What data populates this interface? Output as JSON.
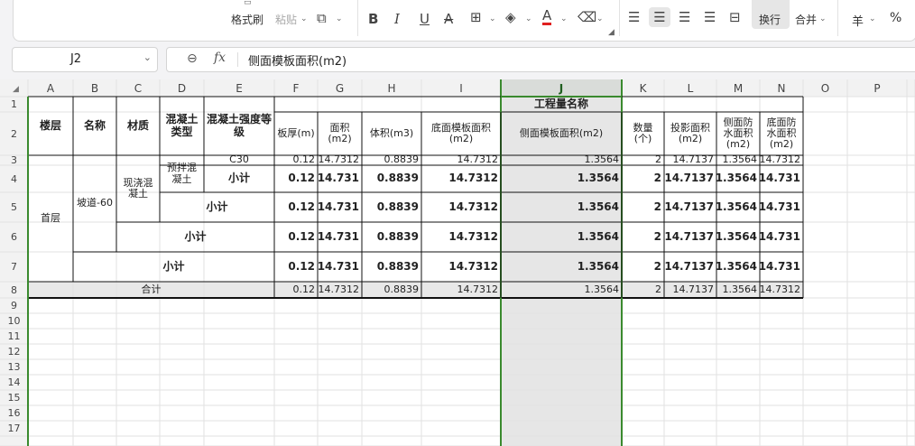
{
  "ribbon": {
    "format_painter": "格式刷",
    "paste": "粘贴",
    "bold": "B",
    "italic": "I",
    "underline": "U",
    "strike": "A",
    "font_color": "A",
    "wrap_text": "换行",
    "merge": "合并",
    "currency": "羊",
    "percent": "%"
  },
  "formula_bar": {
    "name_box": "J2",
    "formula": "侧面模板面积(m2)"
  },
  "columns": [
    "A",
    "B",
    "C",
    "D",
    "E",
    "F",
    "G",
    "H",
    "I",
    "J",
    "K",
    "L",
    "M",
    "N",
    "O",
    "P"
  ],
  "rows": [
    "1",
    "2",
    "3",
    "4",
    "5",
    "6",
    "7",
    "8",
    "9",
    "10",
    "11",
    "12",
    "13",
    "14",
    "15",
    "16",
    "17"
  ],
  "table": {
    "header_group": "工程量名称",
    "headers": {
      "A": "楼层",
      "B": "名称",
      "C": "材质",
      "D": "混凝土类型",
      "E": "混凝土强度等级",
      "F": "板厚(m)",
      "G": "面积(m2)",
      "H": "体积(m3)",
      "I": "底面模板面积(m2)",
      "J": "侧面模板面积(m2)",
      "K": "数量(个)",
      "L": "投影面积(m2)",
      "M": "侧面防水面积(m2)",
      "N": "底面防水面积(m2)"
    },
    "floor": "首层",
    "name": "坡道-60",
    "material": "现浇混凝土",
    "concrete_type": "预拌混凝土",
    "grade": "C30",
    "subtotal": "小计",
    "total": "合计",
    "detail_row": [
      "0.12",
      "14.7312",
      "0.8839",
      "14.7312",
      "1.3564",
      "2",
      "14.7137",
      "1.3564",
      "14.7312"
    ],
    "subtotal_row": [
      "0.12",
      "14.731",
      "0.8839",
      "14.7312",
      "1.3564",
      "2",
      "14.7137",
      "1.3564",
      "14.731"
    ],
    "total_row": [
      "0.12",
      "14.7312",
      "0.8839",
      "14.7312",
      "1.3564",
      "2",
      "14.7137",
      "1.3564",
      "14.7312"
    ]
  }
}
